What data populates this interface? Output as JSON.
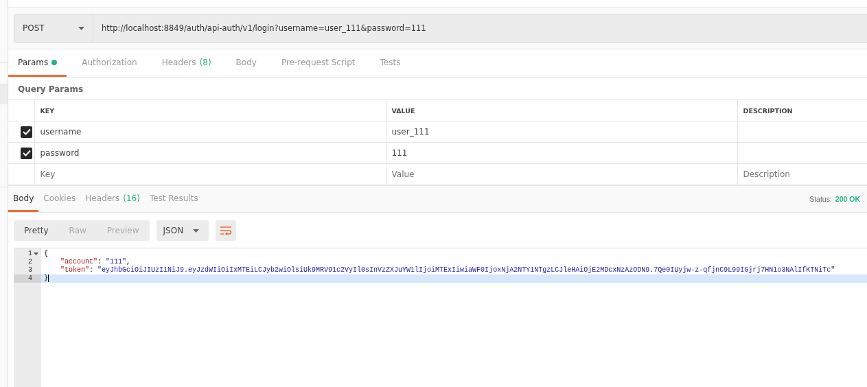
{
  "request": {
    "method": "POST",
    "url": "http://localhost:8849/auth/api-auth/v1/login?username=user_111&password=111"
  },
  "request_tabs": [
    {
      "label": "Params",
      "dot": true,
      "selected": true
    },
    {
      "label": "Authorization",
      "dot": false,
      "selected": false
    },
    {
      "label": "Headers",
      "count": "(8)",
      "dot": false,
      "selected": false
    },
    {
      "label": "Body",
      "dot": false,
      "selected": false
    },
    {
      "label": "Pre-request Script",
      "dot": false,
      "selected": false
    },
    {
      "label": "Tests",
      "dot": false,
      "selected": false
    }
  ],
  "query_params": {
    "title": "Query Params",
    "columns": [
      "KEY",
      "VALUE",
      "DESCRIPTION"
    ],
    "rows": [
      {
        "checked": true,
        "key": "username",
        "value": "user_111"
      },
      {
        "checked": true,
        "key": "password",
        "value": "111"
      }
    ],
    "placeholders": [
      "Key",
      "Value",
      "Description"
    ]
  },
  "response_tabs": [
    {
      "label": "Body",
      "selected": true
    },
    {
      "label": "Cookies",
      "selected": false
    },
    {
      "label": "Headers",
      "count": "(16)",
      "selected": false
    },
    {
      "label": "Test Results",
      "selected": false
    }
  ],
  "status": {
    "label": "Status:",
    "value": "200 OK"
  },
  "view_modes": [
    {
      "label": "Pretty",
      "selected": true
    },
    {
      "label": "Raw",
      "selected": false
    },
    {
      "label": "Preview",
      "selected": false
    }
  ],
  "format": "JSON",
  "code_lines": [
    {
      "number": "1",
      "fold": true,
      "selected": false,
      "parts": [
        {
          "kind": "punct",
          "text": "{"
        }
      ]
    },
    {
      "number": "2",
      "fold": false,
      "selected": false,
      "parts": [
        {
          "kind": "key",
          "text": "    \"account\""
        },
        {
          "kind": "punct",
          "text": ": "
        },
        {
          "kind": "string",
          "text": "\"111\""
        },
        {
          "kind": "punct",
          "text": ","
        }
      ]
    },
    {
      "number": "3",
      "fold": false,
      "selected": false,
      "parts": [
        {
          "kind": "key",
          "text": "    \"token\""
        },
        {
          "kind": "punct",
          "text": ": "
        },
        {
          "kind": "string",
          "text": "\"eyJhbGciOiJIUzI1NiJ9.eyJzdWIiOiIxMTEiLCJyb2wiOlsiUk9MRV91c2VyIl0sInVzZXJuYW1lIjoiMTExIiwiaWF0IjoxNjA2NTY1NTgzLCJleHAiOjE2MDcxNzAzODN9.7Qe0IUyjw-z-qfjnC9L99IGjrj7HN1o3NAlIfKTNiTc\""
        }
      ]
    },
    {
      "number": "4",
      "fold": false,
      "selected": true,
      "parts": [
        {
          "kind": "punct",
          "text": "}"
        }
      ]
    }
  ]
}
